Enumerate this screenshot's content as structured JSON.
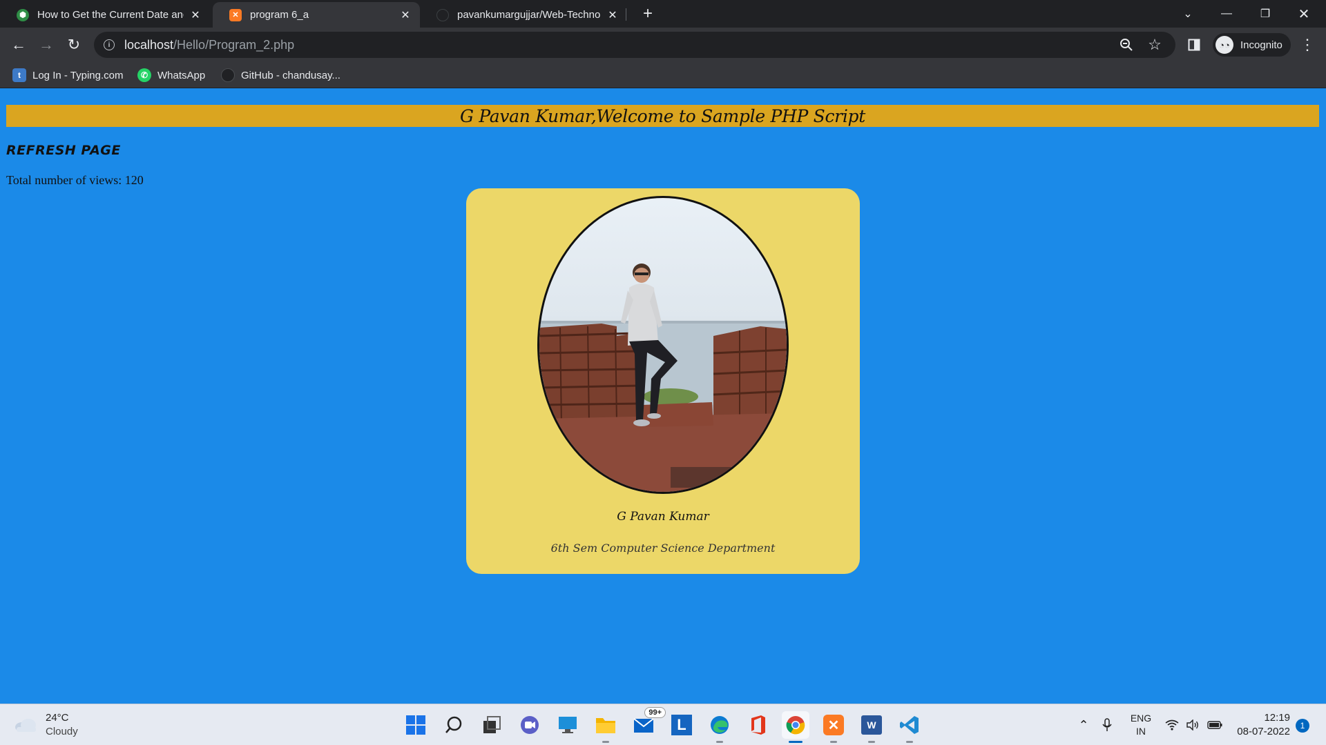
{
  "browser": {
    "tabs": [
      {
        "title": "How to Get the Current Date and",
        "favicon": "geeks-icon",
        "active": false
      },
      {
        "title": "program 6_a",
        "favicon": "xampp-icon",
        "active": true
      },
      {
        "title": "pavankumargujjar/Web-Technolo",
        "favicon": "github-icon",
        "active": false
      }
    ],
    "url_host": "localhost",
    "url_path": "/Hello/Program_2.php",
    "profile_label": "Incognito",
    "bookmarks": [
      {
        "label": "Log In - Typing.com",
        "icon": "typing-icon"
      },
      {
        "label": "WhatsApp",
        "icon": "whatsapp-icon"
      },
      {
        "label": "GitHub - chandusay...",
        "icon": "github-icon"
      }
    ]
  },
  "page": {
    "banner_title": "G Pavan Kumar,Welcome to Sample PHP Script",
    "refresh_label": "REFRESH PAGE",
    "views_text": "Total number of views: 120",
    "card": {
      "name": "G Pavan Kumar",
      "department": "6th Sem Computer Science Department"
    }
  },
  "taskbar": {
    "weather_temp": "24°C",
    "weather_desc": "Cloudy",
    "mail_badge": "99+",
    "lang_top": "ENG",
    "lang_bottom": "IN",
    "time": "12:19",
    "date": "08-07-2022",
    "notification_count": "1"
  },
  "colors": {
    "page_bg": "#1b8ae8",
    "banner_bg": "#daa520",
    "card_bg": "#ecd768"
  }
}
